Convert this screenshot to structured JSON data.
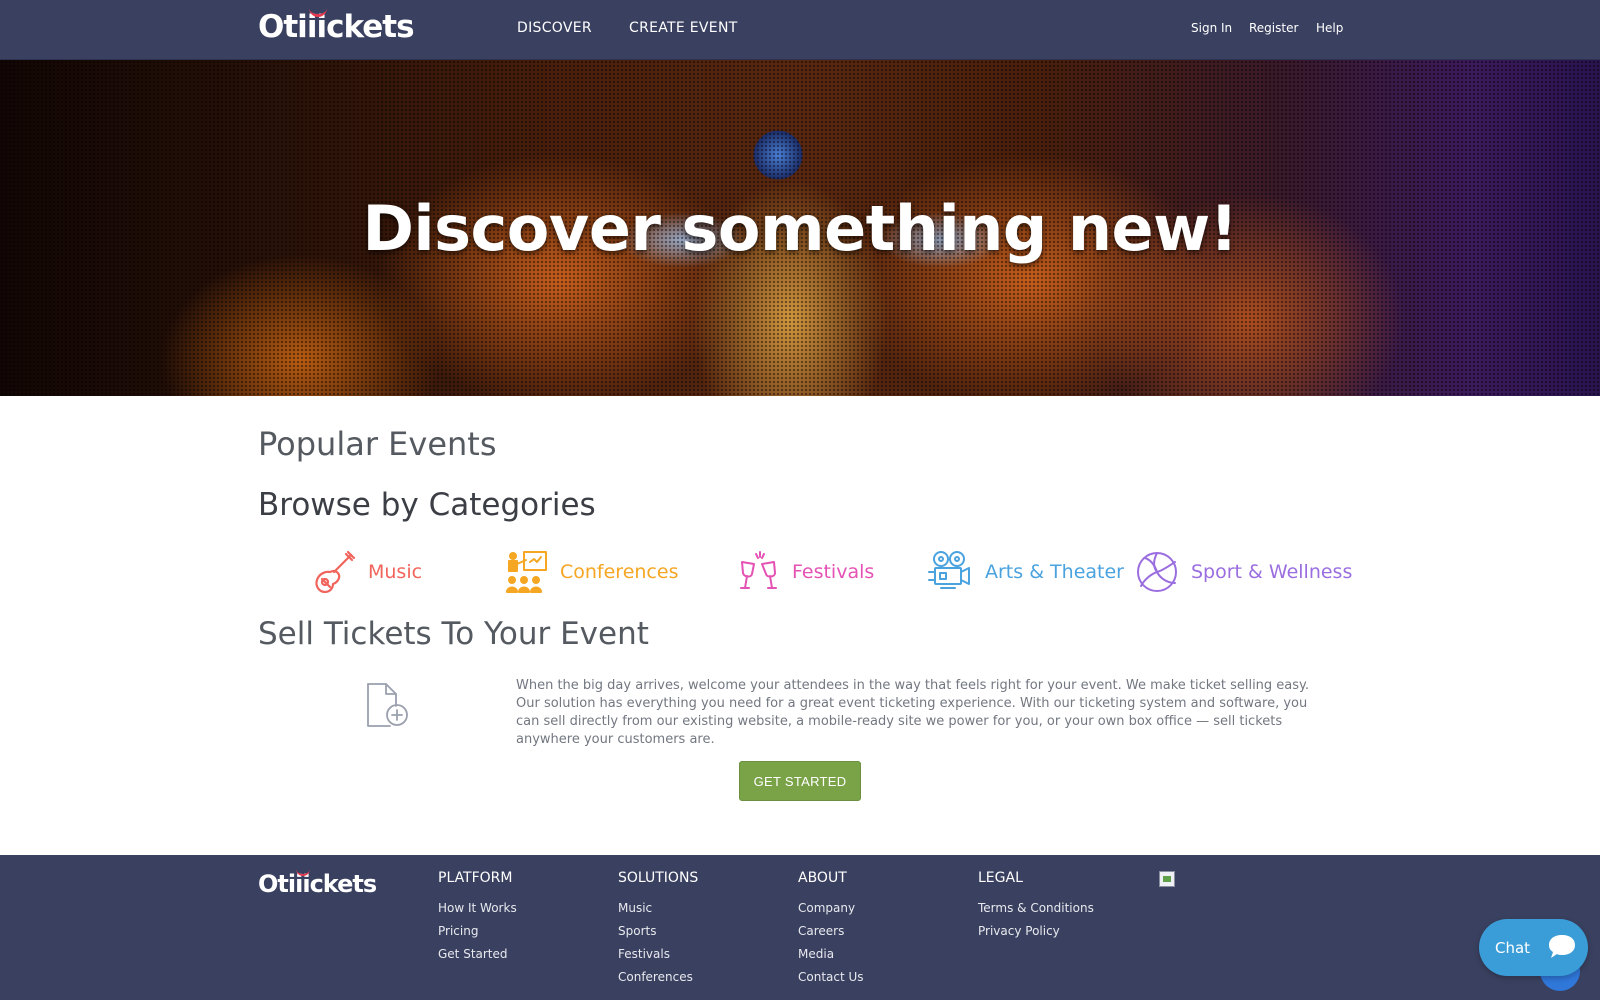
{
  "brand": {
    "logo_text_start": "Oti",
    "logo_text_end": "ickets",
    "logo_smile": "i",
    "accent": "#e53950"
  },
  "nav": {
    "discover": "DISCOVER",
    "create_event": "CREATE EVENT",
    "sign_in": "Sign In",
    "register": "Register",
    "help": "Help"
  },
  "hero": {
    "title": "Discover something new!"
  },
  "popular": {
    "heading": "Popular Events"
  },
  "browse": {
    "heading": "Browse by Categories",
    "categories": [
      {
        "label": "Music",
        "icon": "guitar-icon",
        "color": "#f0645c"
      },
      {
        "label": "Conferences",
        "icon": "presentation-icon",
        "color": "#f5a623"
      },
      {
        "label": "Festivals",
        "icon": "toast-glasses-icon",
        "color": "#e452b4"
      },
      {
        "label": "Arts & Theater",
        "icon": "film-camera-icon",
        "color": "#4aa3df"
      },
      {
        "label": "Sport & Wellness",
        "icon": "volleyball-icon",
        "color": "#9b6ee0"
      }
    ]
  },
  "sell": {
    "heading": "Sell Tickets To Your Event",
    "icon": "file-add-icon",
    "text": "When the big day arrives, welcome your attendees in the way that feels right for your event. We make ticket selling easy. Our solution has everything you need for a great event ticketing experience. With our ticketing system and software, you can sell directly from our existing website, a mobile-ready site we power for you, or your own box office — sell tickets anywhere your customers are.",
    "button": "GET STARTED",
    "button_color": "#7aa348"
  },
  "footer": {
    "columns": [
      {
        "heading": "PLATFORM",
        "links": [
          "How It Works",
          "Pricing",
          "Get Started"
        ]
      },
      {
        "heading": "SOLUTIONS",
        "links": [
          "Music",
          "Sports",
          "Festivals",
          "Conferences"
        ]
      },
      {
        "heading": "ABOUT",
        "links": [
          "Company",
          "Careers",
          "Media",
          "Contact Us"
        ]
      },
      {
        "heading": "LEGAL",
        "links": [
          "Terms & Conditions",
          "Privacy Policy"
        ]
      }
    ]
  },
  "chat": {
    "label": "Chat",
    "color": "#3b9dd8"
  }
}
